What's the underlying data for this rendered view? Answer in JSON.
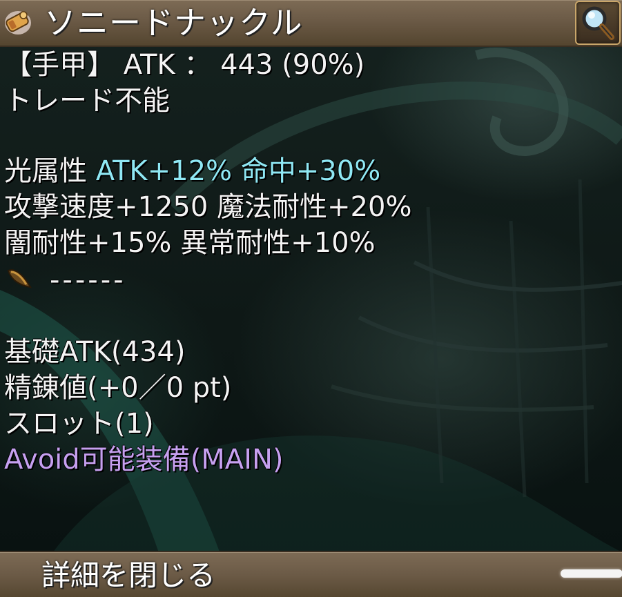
{
  "header": {
    "item_name": "ソニードナックル",
    "item_icon": "knuckle-icon",
    "search_icon": "magnifier-icon"
  },
  "stats": {
    "category": "【手甲】",
    "atk_label": "ATK",
    "separator": "：",
    "atk_value": "443",
    "atk_percent": "(90%)",
    "trade_status": "トレード不能",
    "element_label": "光属性",
    "element_bonus": "ATK+12% 命中+30%",
    "aspd_line": "攻撃速度+1250 魔法耐性+20%",
    "dark_line": "闇耐性+15% 異常耐性+10%",
    "slot_icon": "crystal-slot-icon",
    "slot_text": "------",
    "base_atk": "基礎ATK(434)",
    "refine": "精錬値(+0／0 pt)",
    "slots": "スロット(1)",
    "avoid": "Avoid可能装備(MAIN)"
  },
  "footer": {
    "close_label": "詳細を閉じる"
  },
  "colors": {
    "bonus_cyan": "#8fe8f4",
    "avoid_purple": "#c6a0f0",
    "bar_brown": "#6b5a46"
  }
}
